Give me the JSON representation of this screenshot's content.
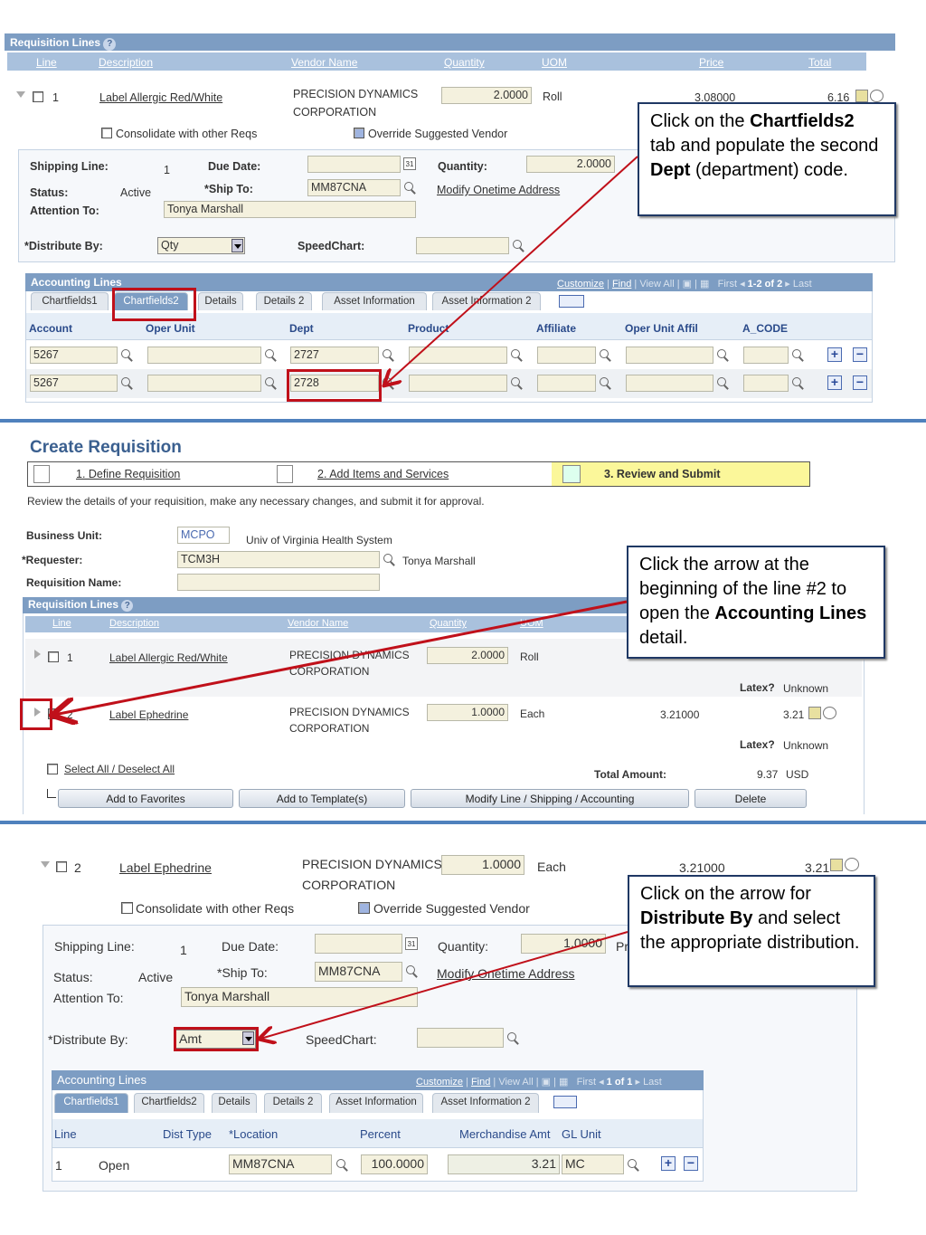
{
  "panel1": {
    "section_title": "Requisition Lines",
    "columns": [
      "Line",
      "Description",
      "Vendor Name",
      "Quantity",
      "UOM",
      "Price",
      "Total"
    ],
    "line": {
      "num": "1",
      "description": "Label Allergic Red/White",
      "vendor1": "PRECISION DYNAMICS",
      "vendor2": "CORPORATION",
      "quantity": "2.0000",
      "uom": "Roll",
      "price": "3.08000",
      "total": "6.16"
    },
    "consolidate": "Consolidate with other Reqs",
    "override": "Override Suggested Vendor",
    "shipping": {
      "shipping_line_label": "Shipping Line:",
      "shipping_line": "1",
      "due_date_label": "Due Date:",
      "quantity_label": "Quantity:",
      "quantity": "2.0000",
      "status_label": "Status:",
      "status": "Active",
      "ship_to_label": "*Ship To:",
      "ship_to": "MM87CNA",
      "modify_link": "Modify Onetime Address",
      "attention_label": "Attention To:",
      "attention": "Tonya Marshall",
      "distribute_label": "*Distribute By:",
      "distribute": "Qty",
      "speedchart_label": "SpeedChart:"
    },
    "accounting": {
      "title": "Accounting Lines",
      "customize": "Customize",
      "find": "Find",
      "view_all": "View All",
      "first": "First",
      "range": "1-2 of 2",
      "last": "Last",
      "tabs": [
        "Chartfields1",
        "Chartfields2",
        "Details",
        "Details 2",
        "Asset Information",
        "Asset Information 2"
      ],
      "columns": [
        "Account",
        "Oper Unit",
        "Dept",
        "Product",
        "Affiliate",
        "Oper Unit Affil",
        "A_CODE"
      ],
      "rows": [
        {
          "account": "5267",
          "dept": "2727"
        },
        {
          "account": "5267",
          "dept": "2728"
        }
      ]
    },
    "callout": {
      "t1": "Click on the ",
      "b1": "Chartfields2",
      "t2": " tab and populate the second ",
      "b2": "Dept",
      "t3": " (department) code."
    }
  },
  "panel2": {
    "page_title": "Create Requisition",
    "steps": [
      "1. Define Requisition",
      "2. Add Items and Services",
      "3. Review and Submit"
    ],
    "instructions": "Review the details of your requisition, make any necessary changes, and submit it for approval.",
    "business_unit_label": "Business Unit:",
    "business_unit": "MCPO",
    "business_unit_desc": "Univ of Virginia Health System",
    "requester_label": "*Requester:",
    "requester": "TCM3H",
    "requester_name": "Tonya Marshall",
    "req_name_label": "Requisition Name:",
    "section_title": "Requisition Lines",
    "columns": [
      "Line",
      "Description",
      "Vendor Name",
      "Quantity",
      "UOM"
    ],
    "lines": [
      {
        "num": "1",
        "description": "Label Allergic Red/White",
        "vendor1": "PRECISION DYNAMICS",
        "vendor2": "CORPORATION",
        "quantity": "2.0000",
        "uom": "Roll",
        "latex_label": "Latex?",
        "latex": "Unknown"
      },
      {
        "num": "2",
        "description": "Label Ephedrine",
        "vendor1": "PRECISION DYNAMICS",
        "vendor2": "CORPORATION",
        "quantity": "1.0000",
        "uom": "Each",
        "price": "3.21000",
        "total": "3.21",
        "latex_label": "Latex?",
        "latex": "Unknown"
      }
    ],
    "select_all": "Select All / Deselect All",
    "total_label": "Total Amount:",
    "total": "9.37",
    "currency": "USD",
    "buttons": [
      "Add to Favorites",
      "Add to Template(s)",
      "Modify Line / Shipping / Accounting",
      "Delete"
    ],
    "callout": {
      "t1": "Click the arrow at the beginning of the line #2 to open the ",
      "b1": "Accounting Lines",
      "t2": " detail."
    }
  },
  "panel3": {
    "line": {
      "num": "2",
      "description": "Label Ephedrine",
      "vendor1": "PRECISION DYNAMICS",
      "vendor2": "CORPORATION",
      "quantity": "1.0000",
      "uom": "Each",
      "price": "3.21000",
      "total": "3.21"
    },
    "consolidate": "Consolidate with other Reqs",
    "override": "Override Suggested Vendor",
    "shipping": {
      "shipping_line_label": "Shipping Line:",
      "shipping_line": "1",
      "due_date_label": "Due Date:",
      "quantity_label": "Quantity:",
      "quantity": "1.0000",
      "price_partial": "Pr",
      "status_label": "Status:",
      "status": "Active",
      "ship_to_label": "*Ship To:",
      "ship_to": "MM87CNA",
      "modify_link": "Modify Onetime Address",
      "attention_label": "Attention To:",
      "attention": "Tonya Marshall",
      "distribute_label": "*Distribute By:",
      "distribute": "Amt",
      "speedchart_label": "SpeedChart:"
    },
    "accounting": {
      "title": "Accounting Lines",
      "customize": "Customize",
      "find": "Find",
      "view_all": "View All",
      "first": "First",
      "range": "1 of 1",
      "last": "Last",
      "tabs": [
        "Chartfields1",
        "Chartfields2",
        "Details",
        "Details 2",
        "Asset Information",
        "Asset Information 2"
      ],
      "columns": [
        "Line",
        "Dist Type",
        "*Location",
        "Percent",
        "Merchandise Amt",
        "GL Unit"
      ],
      "row": {
        "line": "1",
        "dist_type": "Open",
        "location": "MM87CNA",
        "percent": "100.0000",
        "amount": "3.21",
        "gl_unit": "MC"
      }
    },
    "callout": {
      "t1": "Click on the arrow for ",
      "b1": "Distribute By",
      "t2": " and select the appropriate distribution."
    }
  },
  "colors": {
    "accent": "#c0101a",
    "separator": "#4f81bd",
    "header": "#7d9dc3"
  }
}
